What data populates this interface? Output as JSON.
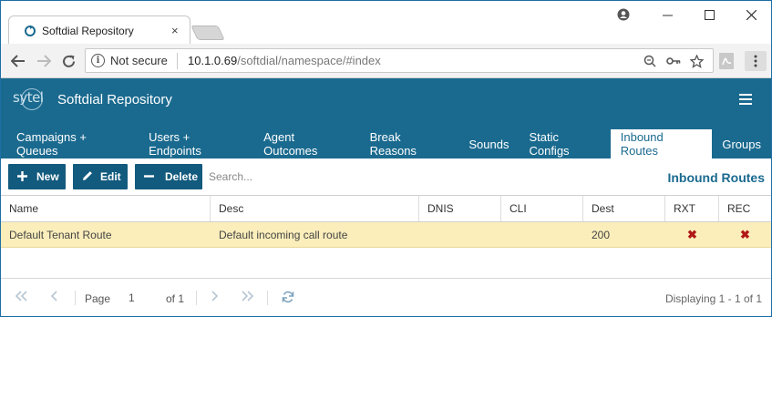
{
  "browser": {
    "tab_title": "Softdial Repository",
    "tab_close": "×",
    "security_label": "Not secure",
    "url_host": "10.1.0.69",
    "url_path": "/softdial/namespace/#index"
  },
  "app": {
    "logo_text": "sytel",
    "title": "Softdial Repository",
    "nav_tabs": [
      {
        "label": "Campaigns + Queues"
      },
      {
        "label": "Users + Endpoints"
      },
      {
        "label": "Agent Outcomes"
      },
      {
        "label": "Break Reasons"
      },
      {
        "label": "Sounds"
      },
      {
        "label": "Static Configs"
      },
      {
        "label": "Inbound Routes"
      },
      {
        "label": "Groups"
      }
    ],
    "active_tab": "Inbound Routes"
  },
  "actions": {
    "new_label": "New",
    "edit_label": "Edit",
    "delete_label": "Delete",
    "search_placeholder": "Search...",
    "section_title": "Inbound Routes"
  },
  "grid": {
    "columns": [
      "Name",
      "Desc",
      "DNIS",
      "CLI",
      "Dest",
      "RXT",
      "REC"
    ],
    "rows": [
      {
        "name": "Default Tenant Route",
        "desc": "Default incoming call route",
        "dnis": "",
        "cli": "",
        "dest": "200",
        "rxt": "✖",
        "rec": "✖"
      }
    ]
  },
  "pager": {
    "page_label": "Page",
    "page_value": "1",
    "of_label": "of 1",
    "displaying": "Displaying 1 - 1 of 1"
  },
  "colors": {
    "header_bg": "#1a6a8f",
    "button_bg": "#125a7e",
    "selected_row": "#fbeebb"
  }
}
